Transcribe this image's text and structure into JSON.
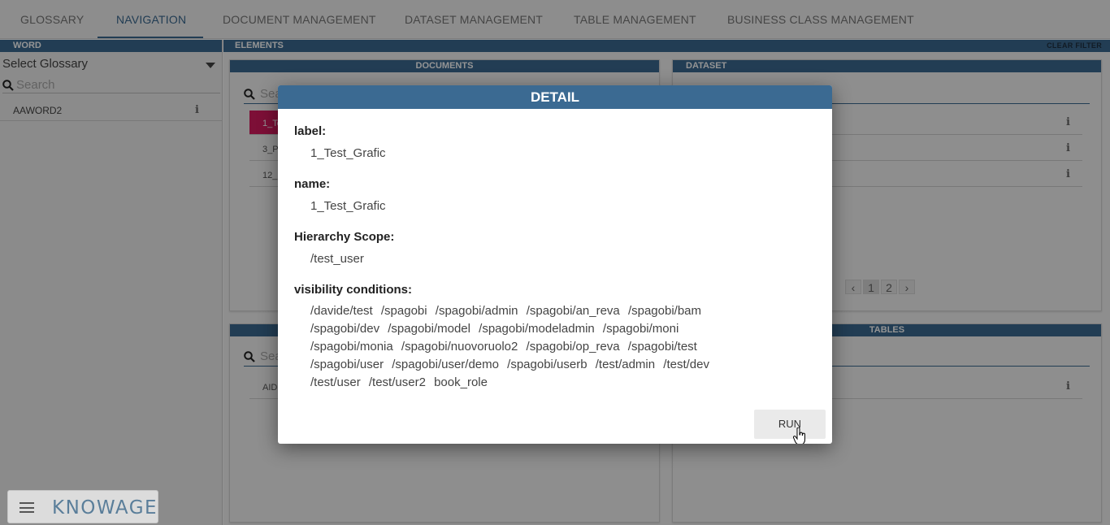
{
  "tabs": [
    {
      "label": "GLOSSARY",
      "active": false
    },
    {
      "label": "NAVIGATION",
      "active": true
    },
    {
      "label": "DOCUMENT MANAGEMENT",
      "active": false
    },
    {
      "label": "DATASET MANAGEMENT",
      "active": false
    },
    {
      "label": "TABLE MANAGEMENT",
      "active": false
    },
    {
      "label": "BUSINESS CLASS MANAGEMENT",
      "active": false
    }
  ],
  "word_panel": {
    "header": "WORD",
    "select_placeholder": "Select Glossary",
    "search_placeholder": "Search",
    "words": [
      {
        "label": "AAWORD2",
        "icon": "info-icon"
      }
    ]
  },
  "elements": {
    "header": "ELEMENTS",
    "clear_filter": "CLEAR FILTER",
    "documents": {
      "header": "DOCUMENTS",
      "search_placeholder": "Search",
      "items": [
        "1_Test_Grafic",
        "3_P",
        "12_"
      ],
      "selected_color": "#d81b60"
    },
    "dataset": {
      "header": "DATASET",
      "pages": [
        "‹",
        "1",
        "2",
        "›"
      ],
      "current_page": "1"
    },
    "bottom_left": {
      "header": "",
      "search_placeholder": "Search",
      "items": [
        "AID"
      ]
    },
    "tables": {
      "header": "TABLES"
    }
  },
  "dialog": {
    "title": "DETAIL",
    "label_title": "label:",
    "label_value": "1_Test_Grafic",
    "name_title": "name:",
    "name_value": "1_Test_Grafic",
    "scope_title": "Hierarchy Scope:",
    "scope_value": "/test_user",
    "visibility_title": "visibility conditions:",
    "visibility": [
      "/davide/test",
      "/spagobi",
      "/spagobi/admin",
      "/spagobi/an_reva",
      "/spagobi/bam",
      "/spagobi/dev",
      "/spagobi/model",
      "/spagobi/modeladmin",
      "/spagobi/moni",
      "/spagobi/monia",
      "/spagobi/nuovoruolo2",
      "/spagobi/op_reva",
      "/spagobi/test",
      "/spagobi/user",
      "/spagobi/user/demo",
      "/spagobi/userb",
      "/test/admin",
      "/test/dev",
      "/test/user",
      "/test/user2",
      "book_role"
    ],
    "run_label": "RUN"
  },
  "logo": {
    "text": "KNOWAGE",
    "menu_icon": "hamburger-icon"
  },
  "colors": {
    "accent": "#3b6a92",
    "overlay": "rgba(0,0,0,0.42)"
  }
}
